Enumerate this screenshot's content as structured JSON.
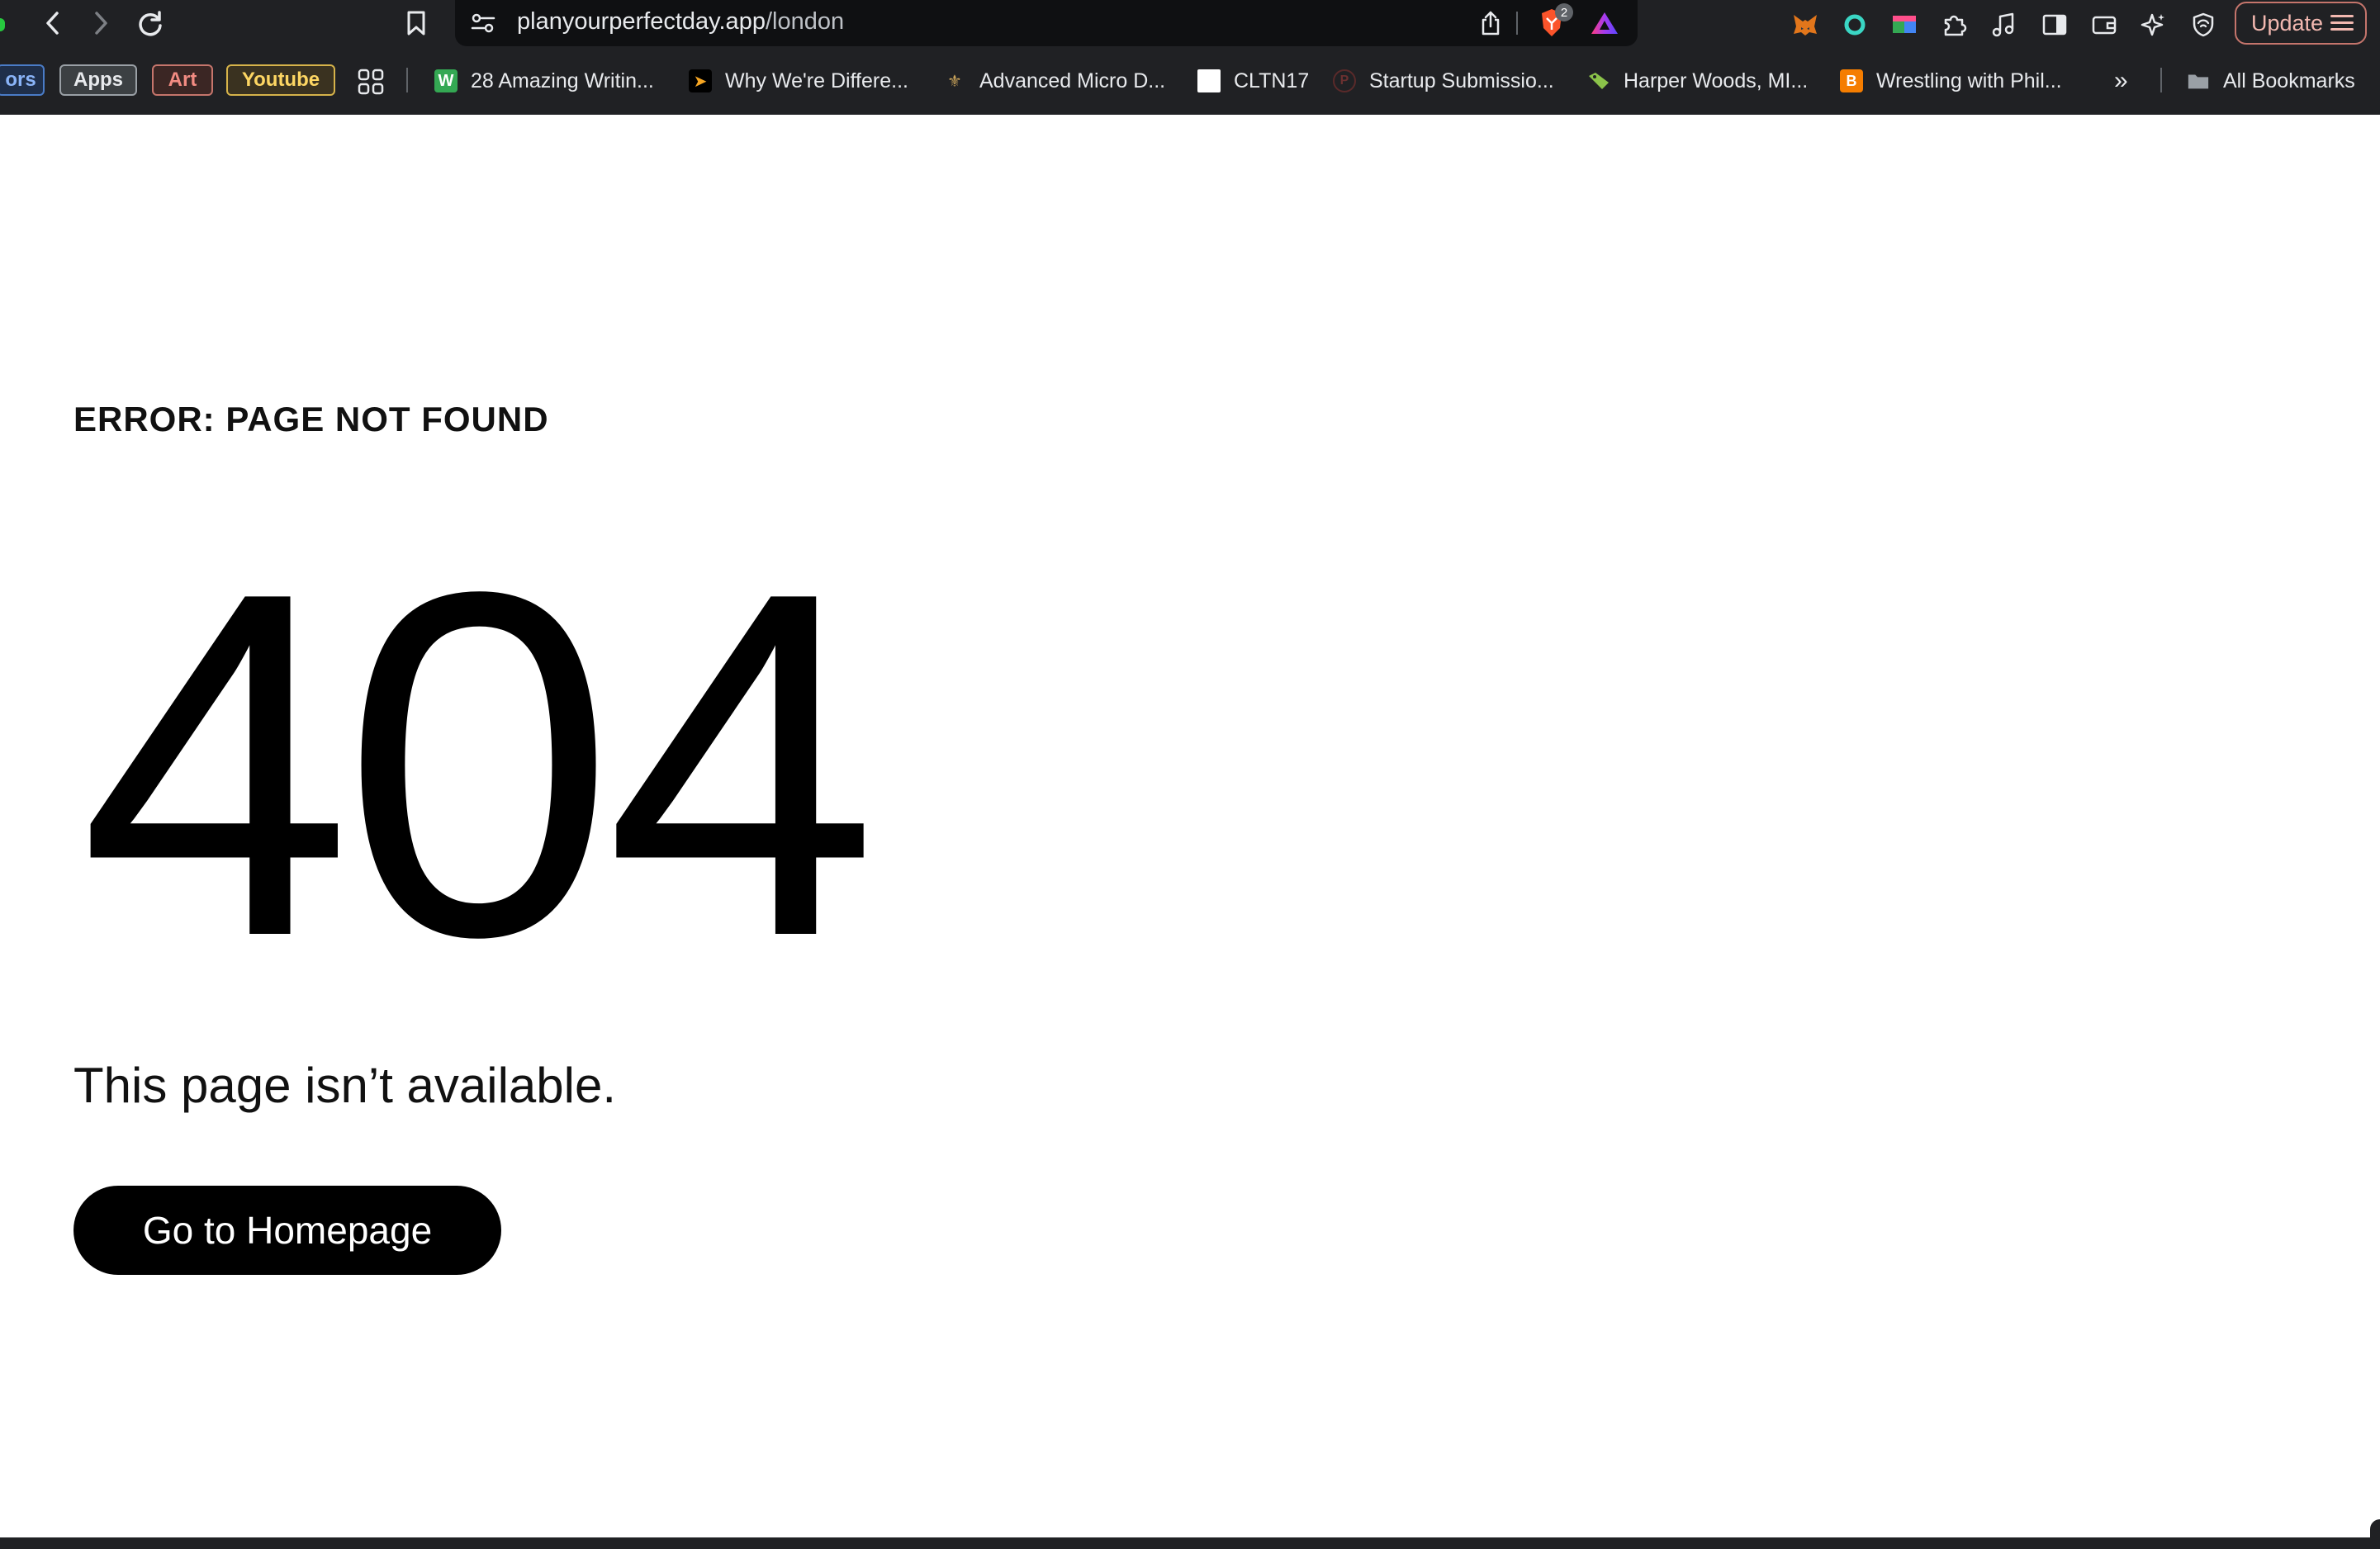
{
  "browser": {
    "url_host": "planyourperfectday.app",
    "url_path": "/london",
    "shields_badge": "2",
    "update_label": "Update",
    "bookmarks_bar": {
      "chips": [
        "ors",
        "Apps",
        "Art",
        "Youtube"
      ],
      "items": [
        {
          "label": "28 Amazing Writin...",
          "icon": "w-favicon"
        },
        {
          "label": "Why We're Differe...",
          "icon": "arrow-favicon"
        },
        {
          "label": "Advanced Micro D...",
          "icon": "shield-crest-favicon"
        },
        {
          "label": "CLTN17",
          "icon": "blank-favicon"
        },
        {
          "label": "Startup Submissio...",
          "icon": "p-favicon"
        },
        {
          "label": "Harper Woods, MI...",
          "icon": "tag-favicon"
        },
        {
          "label": "Wrestling with Phil...",
          "icon": "blogger-favicon"
        }
      ],
      "overflow_label": "»",
      "all_bookmarks_label": "All Bookmarks"
    }
  },
  "page": {
    "error_heading": "ERROR: PAGE NOT FOUND",
    "code": "404",
    "message": "This page isn’t available.",
    "home_button": "Go to Homepage"
  }
}
